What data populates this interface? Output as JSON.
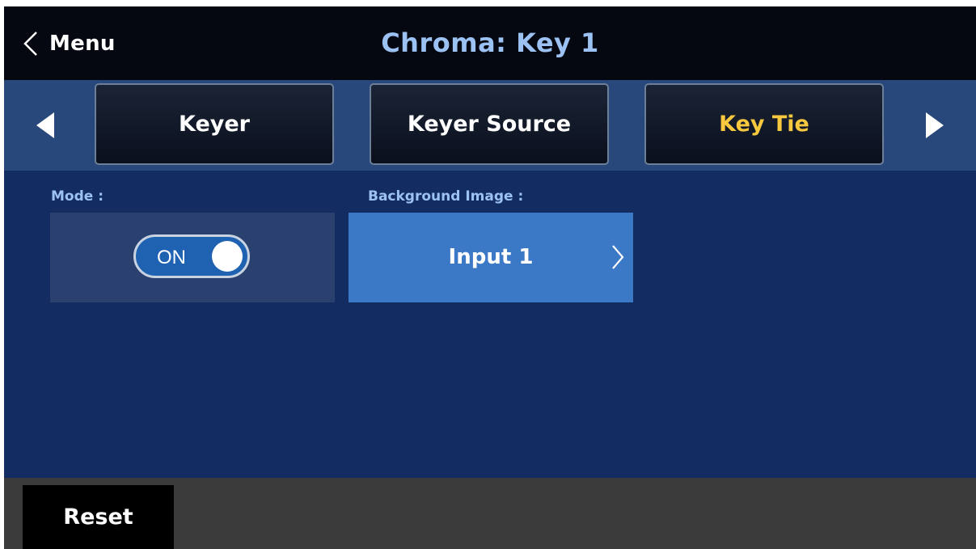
{
  "header": {
    "back_label": "Menu",
    "back_icon": "chevron-left-icon",
    "title": "Chroma: Key 1"
  },
  "tabs": [
    {
      "label": "Keyer",
      "active": false
    },
    {
      "label": "Keyer Source",
      "active": false
    },
    {
      "label": "Key Tie",
      "active": true
    }
  ],
  "nav": {
    "prev_icon": "triangle-left-icon",
    "next_icon": "triangle-right-icon"
  },
  "mode": {
    "label": "Mode :",
    "toggle_text": "ON",
    "state": "on"
  },
  "background_image": {
    "label": "Background Image :",
    "value": "Input 1",
    "icon": "chevron-right-icon"
  },
  "footer": {
    "reset_label": "Reset"
  },
  "colors": {
    "title_blue": "#9cc2f3",
    "active_tab_yellow": "#f8c93f",
    "panel_blue": "#132c62",
    "button_blue": "#3b78c6"
  }
}
